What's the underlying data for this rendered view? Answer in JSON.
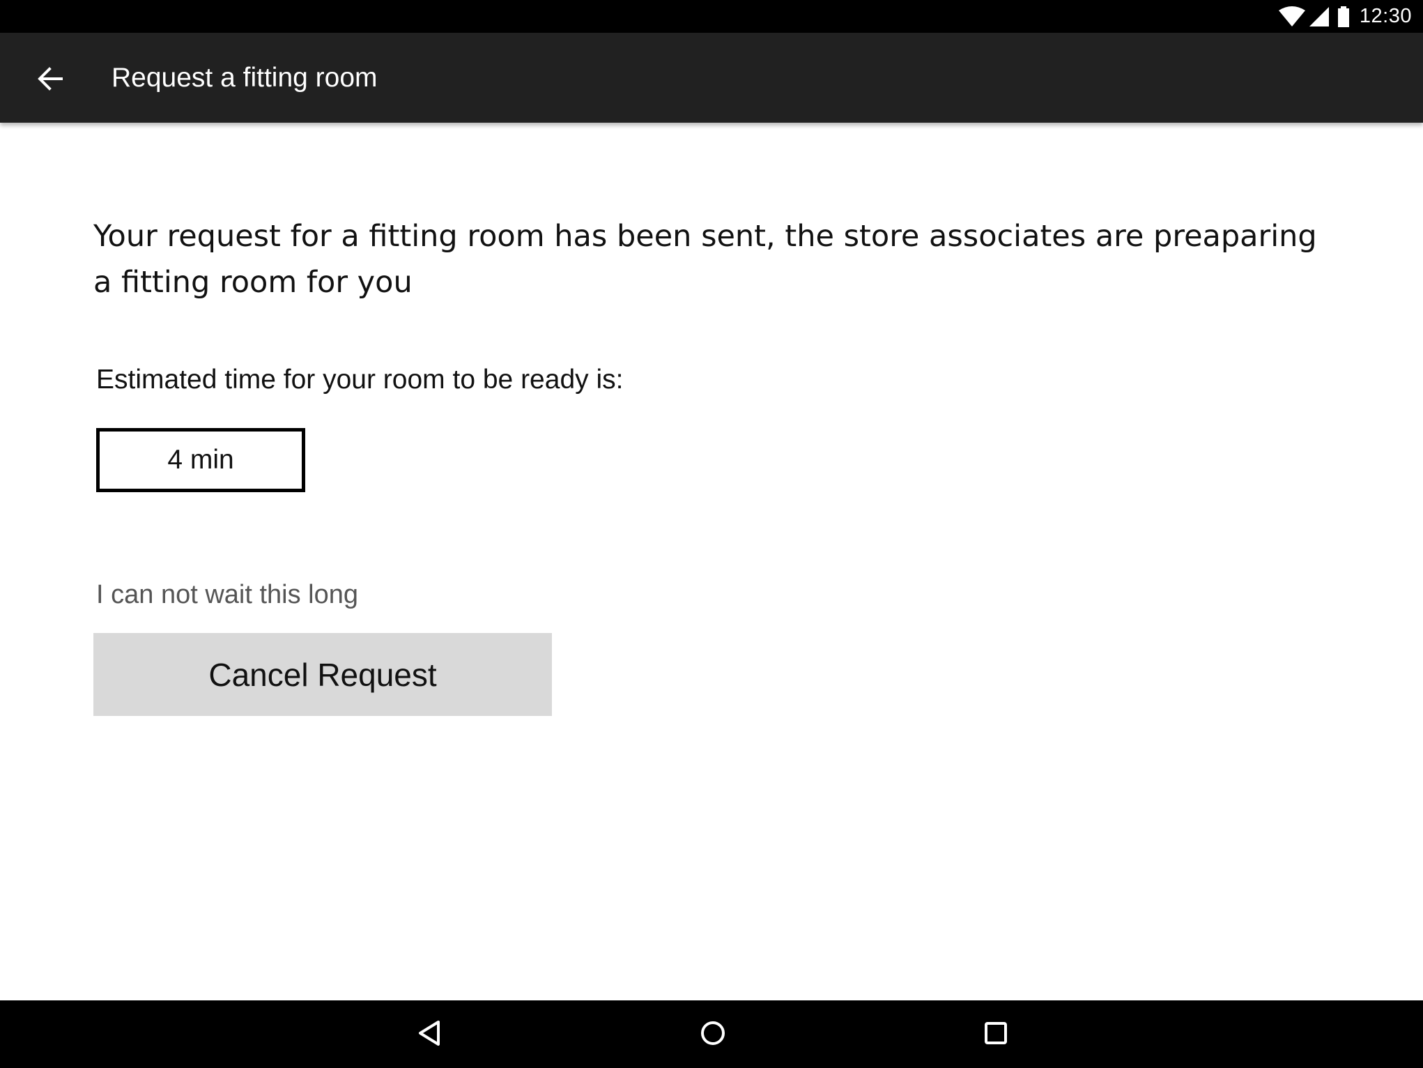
{
  "status_bar": {
    "time": "12:30",
    "icons": [
      "wifi-icon",
      "cell-signal-icon",
      "battery-icon"
    ]
  },
  "app_bar": {
    "back_icon": "arrow-back-icon",
    "title": "Request a fitting room",
    "background": "#212121"
  },
  "main": {
    "message": "Your request for a fitting room has been sent, the store associates are preaparing a fitting room for you",
    "estimate_label": "Estimated time for your room to be ready is:",
    "estimate_value": "4 min",
    "cant_wait_text": "I can not wait this long",
    "cancel_button_label": "Cancel Request",
    "cancel_button_color": "#d9d9d9"
  },
  "nav_bar": {
    "icons": [
      "nav-back-icon",
      "nav-home-icon",
      "nav-recents-icon"
    ]
  }
}
